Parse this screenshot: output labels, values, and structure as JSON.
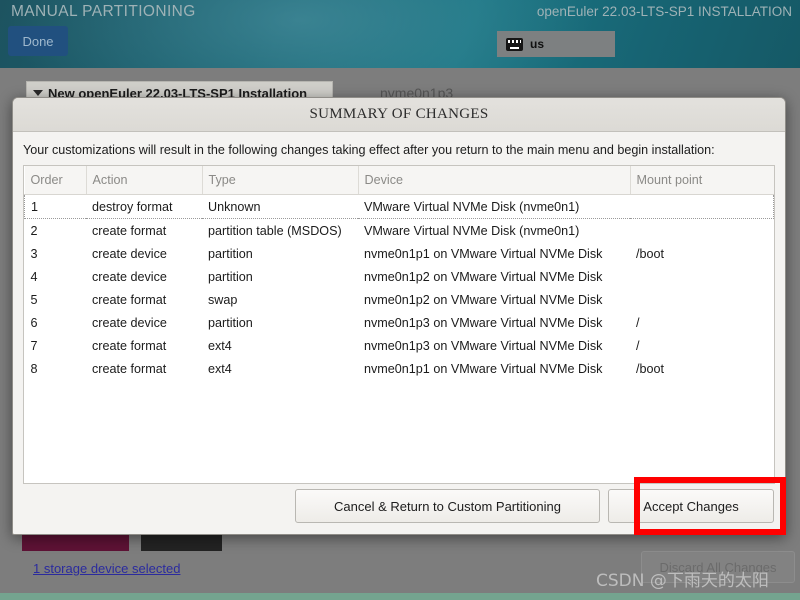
{
  "installer": {
    "screen_title": "MANUAL PARTITIONING",
    "product_title": "openEuler 22.03-LTS-SP1 INSTALLATION",
    "done_label": "Done",
    "keyboard_icon": "keyboard-icon",
    "keyboard_layout": "us",
    "expander_label": "New openEuler 22.03-LTS-SP1 Installation",
    "expander_icon": "chevron-down-icon",
    "partition_label": "nvme0n1p3",
    "storage_link": "1 storage device selected",
    "discard_label": "Discard All Changes",
    "watermark": "CSDN @下雨天的太阳"
  },
  "dialog": {
    "title": "SUMMARY OF CHANGES",
    "intro": "Your customizations will result in the following changes taking effect after you return to the main menu and begin installation:",
    "columns": [
      "Order",
      "Action",
      "Type",
      "Device",
      "Mount point"
    ],
    "rows": [
      {
        "order": "1",
        "action": "destroy format",
        "action_kind": "destroy",
        "type": "Unknown",
        "device": "VMware Virtual NVMe Disk (nvme0n1)",
        "mount": "",
        "selected": true
      },
      {
        "order": "2",
        "action": "create format",
        "action_kind": "create",
        "type": "partition table (MSDOS)",
        "device": "VMware Virtual NVMe Disk (nvme0n1)",
        "mount": "",
        "selected": false
      },
      {
        "order": "3",
        "action": "create device",
        "action_kind": "create",
        "type": "partition",
        "device": "nvme0n1p1 on VMware Virtual NVMe Disk",
        "mount": "/boot",
        "selected": false
      },
      {
        "order": "4",
        "action": "create device",
        "action_kind": "create",
        "type": "partition",
        "device": "nvme0n1p2 on VMware Virtual NVMe Disk",
        "mount": "",
        "selected": false
      },
      {
        "order": "5",
        "action": "create format",
        "action_kind": "create",
        "type": "swap",
        "device": "nvme0n1p2 on VMware Virtual NVMe Disk",
        "mount": "",
        "selected": false
      },
      {
        "order": "6",
        "action": "create device",
        "action_kind": "create",
        "type": "partition",
        "device": "nvme0n1p3 on VMware Virtual NVMe Disk",
        "mount": "/",
        "selected": false
      },
      {
        "order": "7",
        "action": "create format",
        "action_kind": "create",
        "type": "ext4",
        "device": "nvme0n1p3 on VMware Virtual NVMe Disk",
        "mount": "/",
        "selected": false
      },
      {
        "order": "8",
        "action": "create format",
        "action_kind": "create",
        "type": "ext4",
        "device": "nvme0n1p1 on VMware Virtual NVMe Disk",
        "mount": "/boot",
        "selected": false
      }
    ],
    "cancel_label": "Cancel & Return to Custom Partitioning",
    "accept_label": "Accept Changes"
  },
  "colors": {
    "destroy": "#e2252a",
    "create": "#2e9e3e",
    "highlight": "#ff0000",
    "accent_blue": "#21507f",
    "banner_teal": "#17616f",
    "link": "#2b2b9e"
  }
}
